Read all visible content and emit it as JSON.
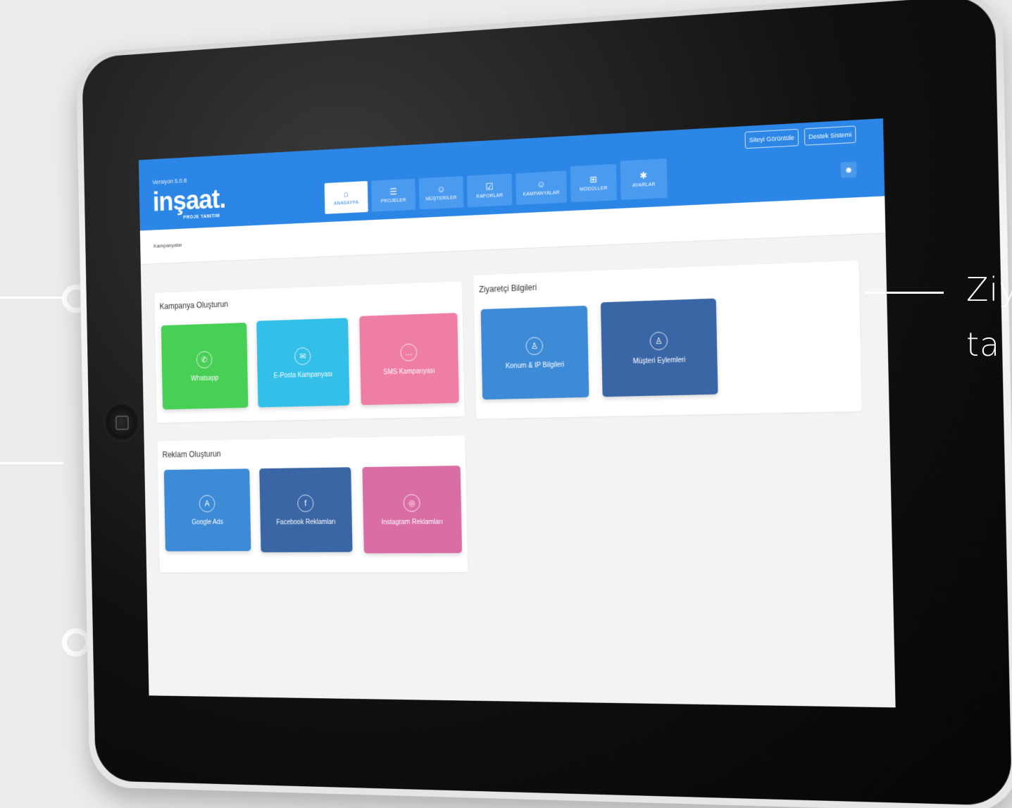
{
  "app": {
    "version": "Versiyon 5.0.8",
    "logo_text": "inşaat.",
    "logo_sub": "PROJE TANITIM"
  },
  "top_actions": {
    "view_site": "Siteyi Görüntüle",
    "support": "Destek Sistemi",
    "user_icon": "user-icon"
  },
  "nav": [
    {
      "label": "ANASAYFA",
      "icon": "home-icon",
      "glyph": "⌂"
    },
    {
      "label": "PROJELER",
      "icon": "list-icon",
      "glyph": "☰"
    },
    {
      "label": "MÜŞTERİLER",
      "icon": "customers-icon",
      "glyph": "☺"
    },
    {
      "label": "RAPORLAR",
      "icon": "clipboard-icon",
      "glyph": "☑"
    },
    {
      "label": "KAMPANYALAR",
      "icon": "campaign-icon",
      "glyph": "☺"
    },
    {
      "label": "MODÜLLER",
      "icon": "modules-icon",
      "glyph": "⊞"
    },
    {
      "label": "AYARLAR",
      "icon": "gear-icon",
      "glyph": "✱"
    }
  ],
  "breadcrumb": "Kampanyalar",
  "sections": {
    "campaign": {
      "title": "Kampanya Oluşturun",
      "tiles": [
        {
          "label": "Whatsapp",
          "icon": "whatsapp-icon",
          "glyph": "✆",
          "color": "#47cf56"
        },
        {
          "label": "E-Posta Kampanyası",
          "icon": "email-icon",
          "glyph": "✉",
          "color": "#33bfe8"
        },
        {
          "label": "SMS Kampanyası",
          "icon": "sms-icon",
          "glyph": "…",
          "color": "#ee7ea4"
        }
      ]
    },
    "visitor": {
      "title": "Ziyaretçi Bilgileri",
      "tiles": [
        {
          "label": "Konum & IP Bilgileri",
          "icon": "location-user-icon",
          "glyph": "♙",
          "color": "#3d8ad6"
        },
        {
          "label": "Müşteri Eylemleri",
          "icon": "customer-actions-icon",
          "glyph": "♙",
          "color": "#3a66a5"
        }
      ]
    },
    "ads": {
      "title": "Reklam Oluşturun",
      "tiles": [
        {
          "label": "Google Ads",
          "icon": "google-ads-icon",
          "glyph": "A",
          "color": "#3d8ad6"
        },
        {
          "label": "Facebook Reklamları",
          "icon": "facebook-icon",
          "glyph": "f",
          "color": "#3a66a5"
        },
        {
          "label": "Instagram Reklamları",
          "icon": "instagram-icon",
          "glyph": "◎",
          "color": "#d96ea5"
        }
      ]
    }
  },
  "side_text": {
    "line1": "Ziy",
    "line2": "ta"
  }
}
